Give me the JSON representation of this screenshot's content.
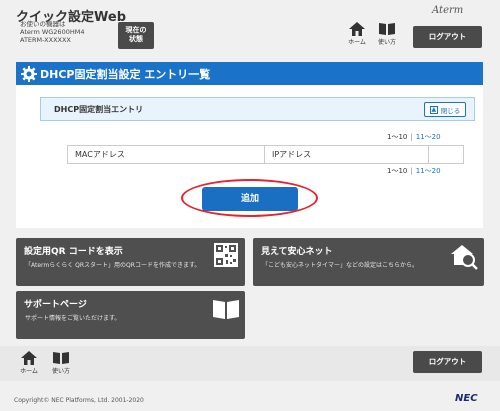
{
  "header": {
    "app_title": "クイック設定Web",
    "model_label": "お使いの機器は",
    "model_name": "Aterm WG2600HM4",
    "model_id": "ATERM-XXXXXX",
    "status_button": [
      "現在の",
      "状態"
    ],
    "brand": "Aterm",
    "home_label": "ホーム",
    "howto_label": "使い方",
    "logout_label": "ログアウト"
  },
  "main": {
    "page_title": "DHCP固定割当設定 エントリ一覧",
    "entry_section_label": "DHCP固定割当エントリ",
    "close_label": "閉じる",
    "pager_top": [
      "1〜10",
      "11〜20"
    ],
    "pager_bottom": [
      "1〜10",
      "11〜20"
    ],
    "table_headers": [
      "MACアドレス",
      "IPアドレス",
      ""
    ],
    "add_button": "追加"
  },
  "cards": [
    {
      "title": "設定用QR コードを表示",
      "desc": "「Atermらくらく QRスタート」用のQRコードを作成できます。",
      "icon": "qr-code-icon"
    },
    {
      "title": "見えて安心ネット",
      "desc": "「こども安心ネットタイマー」などの設定はこちらから。",
      "icon": "house-search-icon"
    },
    {
      "title": "サポートページ",
      "desc": "サポート情報をご覧いただけます。",
      "icon": "book-icon"
    }
  ],
  "footer": {
    "home_label": "ホーム",
    "howto_label": "使い方",
    "logout_label": "ログアウト",
    "copyright": "Copyright© NEC Platforms, Ltd. 2001-2020",
    "brand": "NEC"
  },
  "colors": {
    "accent_blue": "#1a73c9",
    "dark_button": "#4a4a4a",
    "highlight_red": "#e8222a"
  }
}
